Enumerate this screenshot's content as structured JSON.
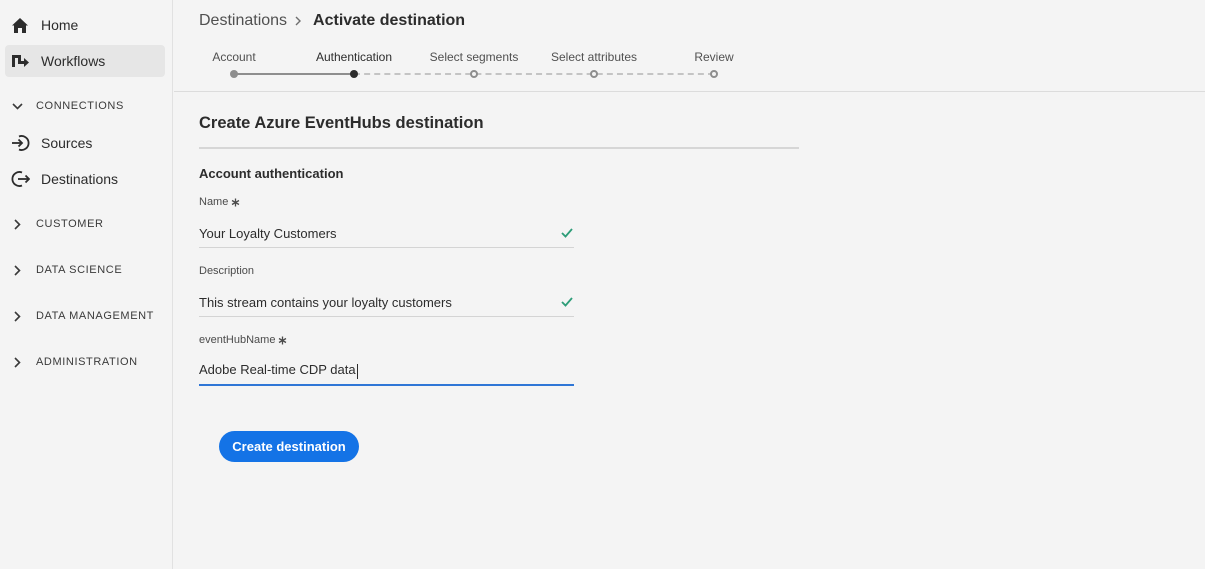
{
  "sidebar": {
    "items": [
      {
        "label": "Home",
        "icon": "home-icon"
      },
      {
        "label": "Workflows",
        "icon": "workflows-icon",
        "active": true
      }
    ],
    "connections_header": "CONNECTIONS",
    "connection_items": [
      {
        "label": "Sources",
        "icon": "sources-icon"
      },
      {
        "label": "Destinations",
        "icon": "destinations-icon"
      }
    ],
    "sections": [
      "CUSTOMER",
      "DATA SCIENCE",
      "DATA MANAGEMENT",
      "ADMINISTRATION"
    ]
  },
  "breadcrumb": {
    "parent": "Destinations",
    "current": "Activate destination"
  },
  "steps": [
    {
      "label": "Account",
      "state": "done"
    },
    {
      "label": "Authentication",
      "state": "current"
    },
    {
      "label": "Select segments",
      "state": "todo"
    },
    {
      "label": "Select attributes",
      "state": "todo"
    },
    {
      "label": "Review",
      "state": "todo"
    }
  ],
  "form": {
    "title": "Create Azure EventHubs destination",
    "section": "Account authentication",
    "fields": [
      {
        "label": "Name",
        "required": true,
        "value": "Your Loyalty Customers",
        "valid": true
      },
      {
        "label": "Description",
        "required": false,
        "value": "This stream contains your loyalty customers",
        "valid": true
      },
      {
        "label": "eventHubName",
        "required": true,
        "value": "Adobe Real-time CDP data",
        "focused": true
      }
    ],
    "submit_label": "Create destination"
  },
  "colors": {
    "accent": "#1473e6",
    "focus": "#2f76d6",
    "valid": "#2d9d78",
    "sidebar_active": "#e6e6e6"
  }
}
